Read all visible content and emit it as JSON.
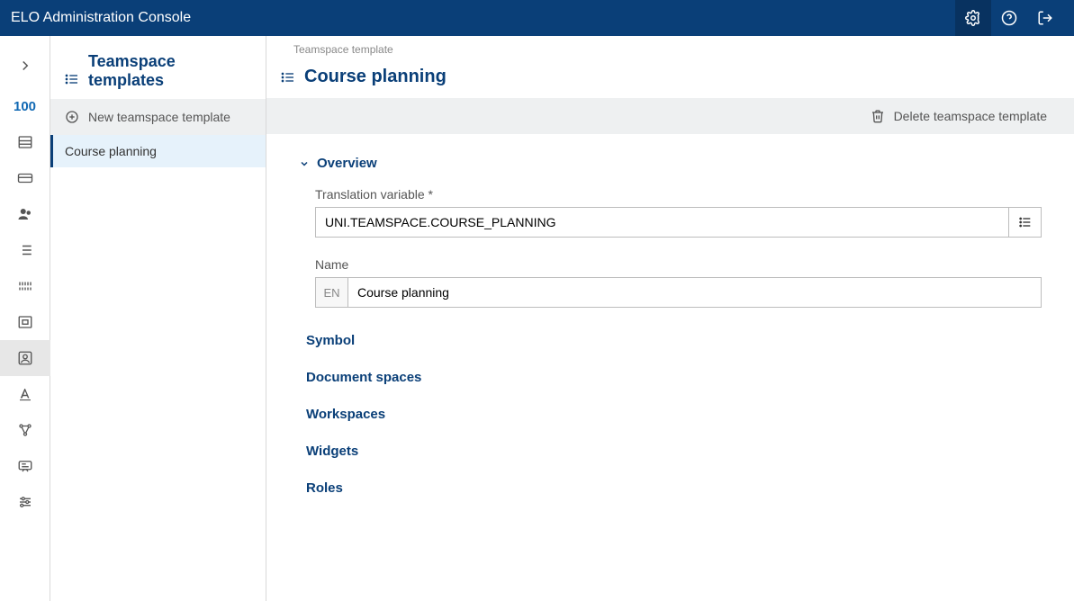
{
  "header": {
    "title": "ELO Administration Console"
  },
  "rail": {
    "percentage": "100"
  },
  "list_panel": {
    "title": "Teamspace templates",
    "new_action": "New teamspace template",
    "items": [
      {
        "label": "Course planning"
      }
    ]
  },
  "detail": {
    "breadcrumb": "Teamspace template",
    "title": "Course planning",
    "delete_action": "Delete teamspace template",
    "sections": {
      "overview": {
        "title": "Overview",
        "translation_variable_label": "Translation variable",
        "translation_variable_value": "UNI.TEAMSPACE.COURSE_PLANNING",
        "name_label": "Name",
        "name_lang": "EN",
        "name_value": "Course planning"
      },
      "symbol": "Symbol",
      "document_spaces": "Document spaces",
      "workspaces": "Workspaces",
      "widgets": "Widgets",
      "roles": "Roles"
    }
  }
}
